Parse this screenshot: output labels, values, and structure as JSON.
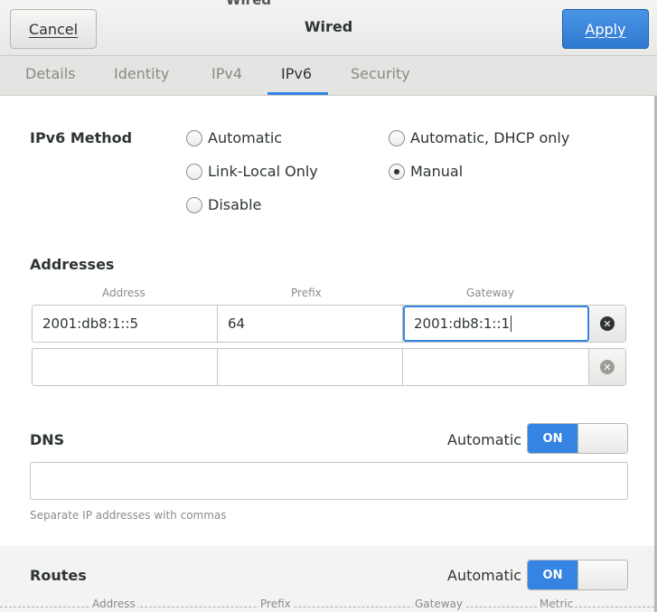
{
  "window": {
    "title": "Wired",
    "title_peek": "Wired"
  },
  "header": {
    "cancel_label": "Cancel",
    "apply_label": "Apply"
  },
  "tabs": [
    {
      "label": "Details",
      "active": false
    },
    {
      "label": "Identity",
      "active": false
    },
    {
      "label": "IPv4",
      "active": false
    },
    {
      "label": "IPv6",
      "active": true
    },
    {
      "label": "Security",
      "active": false
    }
  ],
  "method": {
    "label": "IPv6 Method",
    "options": [
      {
        "label": "Automatic",
        "checked": false
      },
      {
        "label": "Automatic, DHCP only",
        "checked": false
      },
      {
        "label": "Link-Local Only",
        "checked": false
      },
      {
        "label": "Manual",
        "checked": true
      },
      {
        "label": "Disable",
        "checked": false
      }
    ]
  },
  "addresses": {
    "title": "Addresses",
    "columns": [
      "Address",
      "Prefix",
      "Gateway"
    ],
    "rows": [
      {
        "address": "2001:db8:1::5",
        "prefix": "64",
        "gateway": "2001:db8:1::1"
      },
      {
        "address": "",
        "prefix": "",
        "gateway": ""
      }
    ]
  },
  "dns": {
    "title": "DNS",
    "automatic_label": "Automatic",
    "switch_label": "ON",
    "value": "",
    "hint": "Separate IP addresses with commas"
  },
  "routes": {
    "title": "Routes",
    "automatic_label": "Automatic",
    "switch_label": "ON",
    "columns": [
      "Address",
      "Prefix",
      "Gateway",
      "Metric"
    ]
  },
  "colors": {
    "accent": "#3584e4",
    "apply_button": "#2f79d1"
  }
}
